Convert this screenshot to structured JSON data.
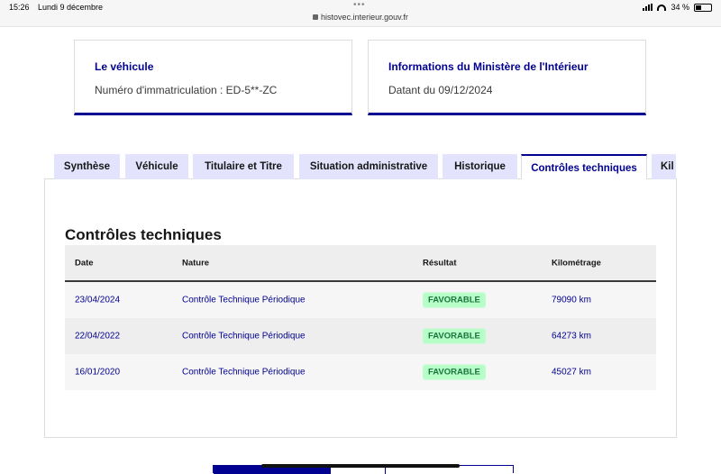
{
  "statusbar": {
    "time": "15:26",
    "date": "Lundi 9 décembre",
    "url": "histovec.interieur.gouv.fr",
    "battery": "34 %",
    "icons": [
      "cellular-signal-icon",
      "wifi-icon",
      "battery-icon",
      "lock-icon"
    ]
  },
  "cards": {
    "vehicle": {
      "title": "Le véhicule",
      "text": "Numéro d'immatriculation : ED-5**-ZC"
    },
    "ministry": {
      "title": "Informations du Ministère de l'Intérieur",
      "text": "Datant du 09/12/2024"
    }
  },
  "tabs": [
    {
      "label": "Synthèse"
    },
    {
      "label": "Véhicule"
    },
    {
      "label": "Titulaire et Titre"
    },
    {
      "label": "Situation administrative"
    },
    {
      "label": "Historique"
    },
    {
      "label": "Contrôles techniques",
      "active": true
    },
    {
      "label": "Kil"
    }
  ],
  "section": {
    "title": "Contrôles techniques"
  },
  "table": {
    "headers": [
      "Date",
      "Nature",
      "Résultat",
      "Kilométrage"
    ],
    "rows": [
      [
        "23/04/2024",
        "Contrôle Technique Périodique",
        "FAVORABLE",
        "79090 km"
      ],
      [
        "22/04/2022",
        "Contrôle Technique Périodique",
        "FAVORABLE",
        "64273 km"
      ],
      [
        "16/01/2020",
        "Contrôle Technique Périodique",
        "FAVORABLE",
        "45027 km"
      ]
    ]
  },
  "colors": {
    "primary": "#000091",
    "tab_bg": "#e3e3fd",
    "badge_bg": "#b8fec9",
    "badge_text": "#18753c"
  }
}
